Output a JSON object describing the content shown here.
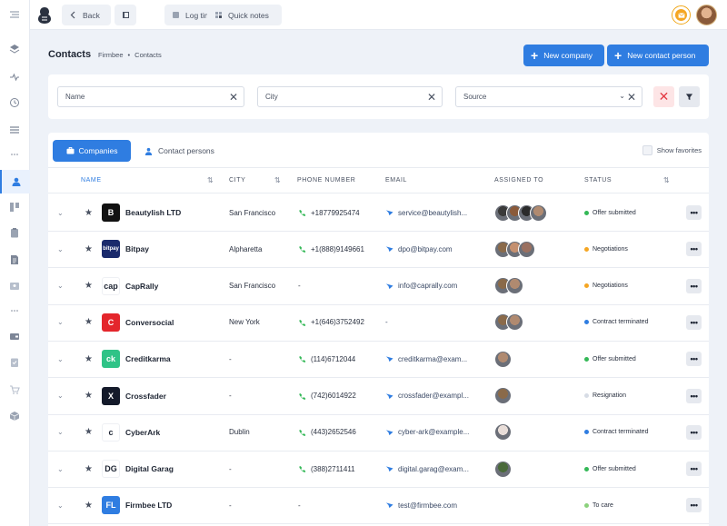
{
  "topbar": {
    "back_label": "Back",
    "log_time_label": "Log time",
    "quick_notes_label": "Quick notes"
  },
  "header": {
    "title": "Contacts",
    "breadcrumb": [
      "Firmbee",
      "Contacts"
    ],
    "new_company_label": "New company",
    "new_contact_label": "New contact person"
  },
  "filters": {
    "name_placeholder": "Name",
    "city_placeholder": "City",
    "source_placeholder": "Source"
  },
  "tabs": {
    "companies_label": "Companies",
    "contact_persons_label": "Contact persons",
    "show_favorites_label": "Show favorites"
  },
  "columns": {
    "name": "NAME",
    "city": "CITY",
    "phone": "PHONE NUMBER",
    "email": "EMAIL",
    "assigned": "ASSIGNED TO",
    "status": "STATUS"
  },
  "status_colors": {
    "Offer submitted": "#34b857",
    "Negotiations": "#f5a623",
    "Contract terminated": "#2f7de1",
    "Resignation": "#d7dce5",
    "To care": "#8bd17c"
  },
  "rows": [
    {
      "name": "Beautylish LTD",
      "logo": "B",
      "logo_bg": "#111111",
      "city": "San Francisco",
      "phone": "+18779925474",
      "email": "service@beautylish...",
      "assigned": [
        "#3a3a3a",
        "#8a5a3a",
        "#2b2b2b",
        "#b08a70"
      ],
      "status": "Offer submitted"
    },
    {
      "name": "Bitpay",
      "logo": "bitpay",
      "logo_bg": "#1a2a6c",
      "city": "Alpharetta",
      "phone": "+1(888)9149661",
      "email": "dpo@bitpay.com",
      "assigned": [
        "#8a6a4a",
        "#c49070",
        "#9a7060"
      ],
      "status": "Negotiations"
    },
    {
      "name": "CapRally",
      "logo": "cap",
      "logo_bg": "#ffffff",
      "city": "San Francisco",
      "phone": "-",
      "email": "info@caprally.com",
      "assigned": [
        "#8a6a4a",
        "#b08a70"
      ],
      "status": "Negotiations"
    },
    {
      "name": "Conversocial",
      "logo": "C",
      "logo_bg": "#e4262c",
      "city": "New York",
      "phone": "+1(646)3752492",
      "email": "-",
      "assigned": [
        "#8a6a4a",
        "#b08a70"
      ],
      "status": "Contract terminated"
    },
    {
      "name": "Creditkarma",
      "logo": "ck",
      "logo_bg": "#2fc387",
      "city": "-",
      "phone": "(114)6712044",
      "email": "creditkarma@exam...",
      "assigned": [
        "#b08a70"
      ],
      "status": "Offer submitted"
    },
    {
      "name": "Crossfader",
      "logo": "X",
      "logo_bg": "#141a2a",
      "city": "-",
      "phone": "(742)6014922",
      "email": "crossfader@exampl...",
      "assigned": [
        "#8a6a4a"
      ],
      "status": "Resignation"
    },
    {
      "name": "CyberArk",
      "logo": "c",
      "logo_bg": "#ffffff",
      "city": "Dublin",
      "phone": "(443)2652546",
      "email": "cyber-ark@example...",
      "assigned": [
        "#e8ddd8"
      ],
      "status": "Contract terminated"
    },
    {
      "name": "Digital Garag",
      "logo": "DG",
      "logo_bg": "#ffffff",
      "city": "-",
      "phone": "(388)2711411",
      "email": "digital.garag@exam...",
      "assigned": [
        "#4a6a3a"
      ],
      "status": "Offer submitted"
    },
    {
      "name": "Firmbee LTD",
      "logo": "FL",
      "logo_bg": "#2f7de1",
      "city": "-",
      "phone": "-",
      "email": "test@firmbee.com",
      "assigned": [],
      "status": "To care"
    }
  ]
}
